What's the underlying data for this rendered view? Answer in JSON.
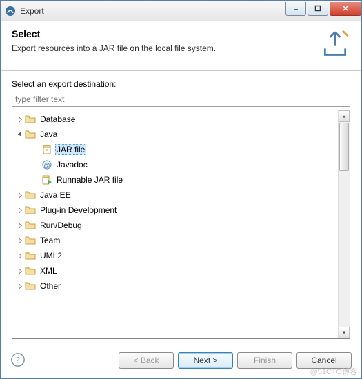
{
  "window": {
    "title": "Export"
  },
  "header": {
    "title": "Select",
    "description": "Export resources into a JAR file on the local file system."
  },
  "destinationLabel": "Select an export destination:",
  "filter": {
    "placeholder": "type filter text",
    "value": ""
  },
  "tree": {
    "expanded": "Java",
    "selected": "JAR file",
    "nodes": [
      {
        "label": "Database",
        "type": "folder",
        "depth": 0,
        "expanded": false
      },
      {
        "label": "Java",
        "type": "folder",
        "depth": 0,
        "expanded": true
      },
      {
        "label": "JAR file",
        "type": "jar",
        "depth": 1,
        "selected": true
      },
      {
        "label": "Javadoc",
        "type": "javadoc",
        "depth": 1
      },
      {
        "label": "Runnable JAR file",
        "type": "jar-run",
        "depth": 1
      },
      {
        "label": "Java EE",
        "type": "folder",
        "depth": 0,
        "expanded": false
      },
      {
        "label": "Plug-in Development",
        "type": "folder",
        "depth": 0,
        "expanded": false
      },
      {
        "label": "Run/Debug",
        "type": "folder",
        "depth": 0,
        "expanded": false
      },
      {
        "label": "Team",
        "type": "folder",
        "depth": 0,
        "expanded": false
      },
      {
        "label": "UML2",
        "type": "folder",
        "depth": 0,
        "expanded": false
      },
      {
        "label": "XML",
        "type": "folder",
        "depth": 0,
        "expanded": false
      },
      {
        "label": "Other",
        "type": "folder",
        "depth": 0,
        "expanded": false
      }
    ]
  },
  "buttons": {
    "back": "< Back",
    "next": "Next >",
    "finish": "Finish",
    "cancel": "Cancel"
  },
  "watermark": "@51CTO博客"
}
